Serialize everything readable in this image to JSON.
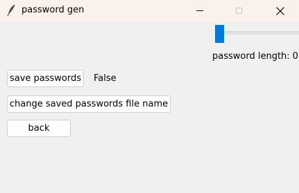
{
  "window": {
    "title": "password gen",
    "app_icon": "feather-icon",
    "controls": [
      "minimize-icon",
      "maximize-icon",
      "close-icon"
    ]
  },
  "slider": {
    "label": "password length:",
    "value": "0",
    "fraction": 0.0,
    "accent_color": "#0078d7"
  },
  "save": {
    "button_label": "save passwords",
    "status": "False"
  },
  "change_file": {
    "button_label": "change saved passwords file name"
  },
  "back": {
    "button_label": "back"
  }
}
